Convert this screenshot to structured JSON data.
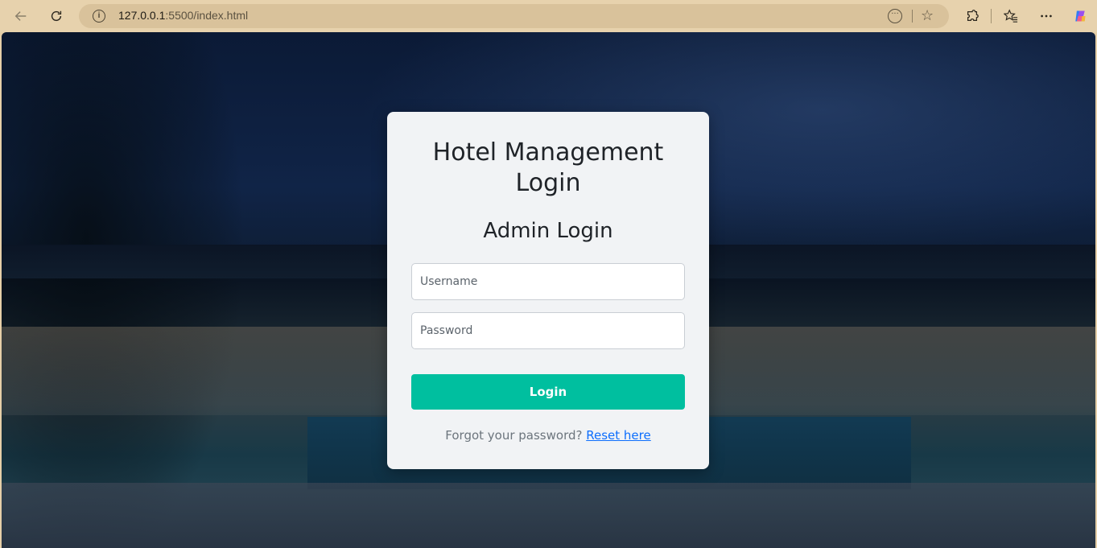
{
  "browser": {
    "url_host": "127.0.0.1",
    "url_path": ":5500/index.html",
    "icons": {
      "back": "back-arrow-icon",
      "refresh": "refresh-icon",
      "info": "site-info-icon",
      "read_aloud": "reading-view-icon",
      "favorite": "star-icon",
      "extensions": "extensions-icon",
      "favorites": "favorites-icon",
      "more": "more-icon",
      "copilot": "copilot-icon"
    }
  },
  "login": {
    "title": "Hotel Management Login",
    "subtitle": "Admin Login",
    "username_placeholder": "Username",
    "password_placeholder": "Password",
    "button_label": "Login",
    "forgot_text": "Forgot your password?",
    "reset_link": "Reset here"
  },
  "colors": {
    "accent": "#00bf9f",
    "link": "#0d6efd",
    "card_bg": "#f1f3f5"
  }
}
